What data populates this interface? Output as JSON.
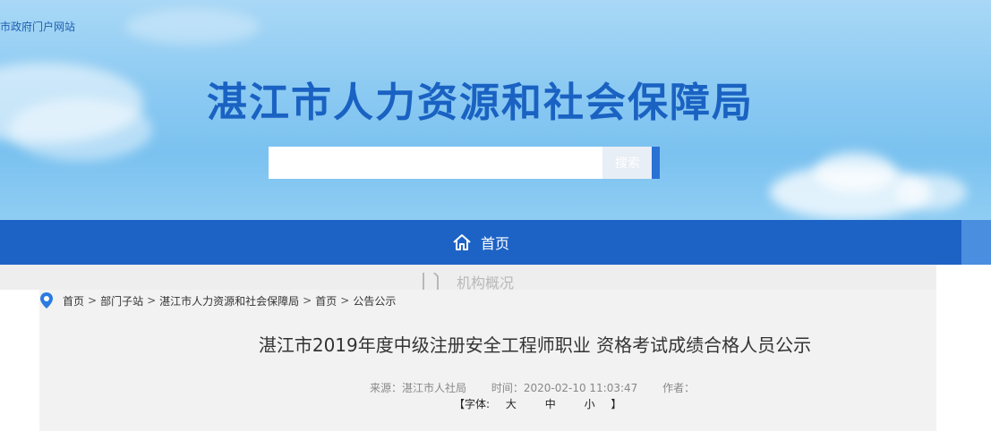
{
  "header": {
    "portal_link": "市政府门户网站",
    "site_title": "湛江市人力资源和社会保障局",
    "search": {
      "value": "",
      "placeholder": "",
      "button_label": "搜索"
    }
  },
  "nav": {
    "items": [
      {
        "label": "首页",
        "icon": "home-icon"
      }
    ],
    "dropdown_item": {
      "label": "机构概况",
      "icon": "document-icon"
    }
  },
  "breadcrumb": {
    "icon": "location-pin-icon",
    "items": [
      "首页",
      "部门子站",
      "湛江市人力资源和社会保障局",
      "首页",
      "公告公示"
    ],
    "separator": ">"
  },
  "article": {
    "title": "湛江市2019年度中级注册安全工程师职业 资格考试成绩合格人员公示",
    "source": "来源：湛江市人社局",
    "time": "时间：2020-02-10 11:03:47",
    "author": "作者：",
    "font_size": {
      "open": "【字体:",
      "large": "大",
      "medium": "中",
      "small": "小",
      "close": "】"
    }
  },
  "colors": {
    "title_blue": "#1a62c2",
    "nav_blue": "#1d63c6",
    "header_sky": "#8ccaf2",
    "content_bg": "#f2f2f2"
  }
}
